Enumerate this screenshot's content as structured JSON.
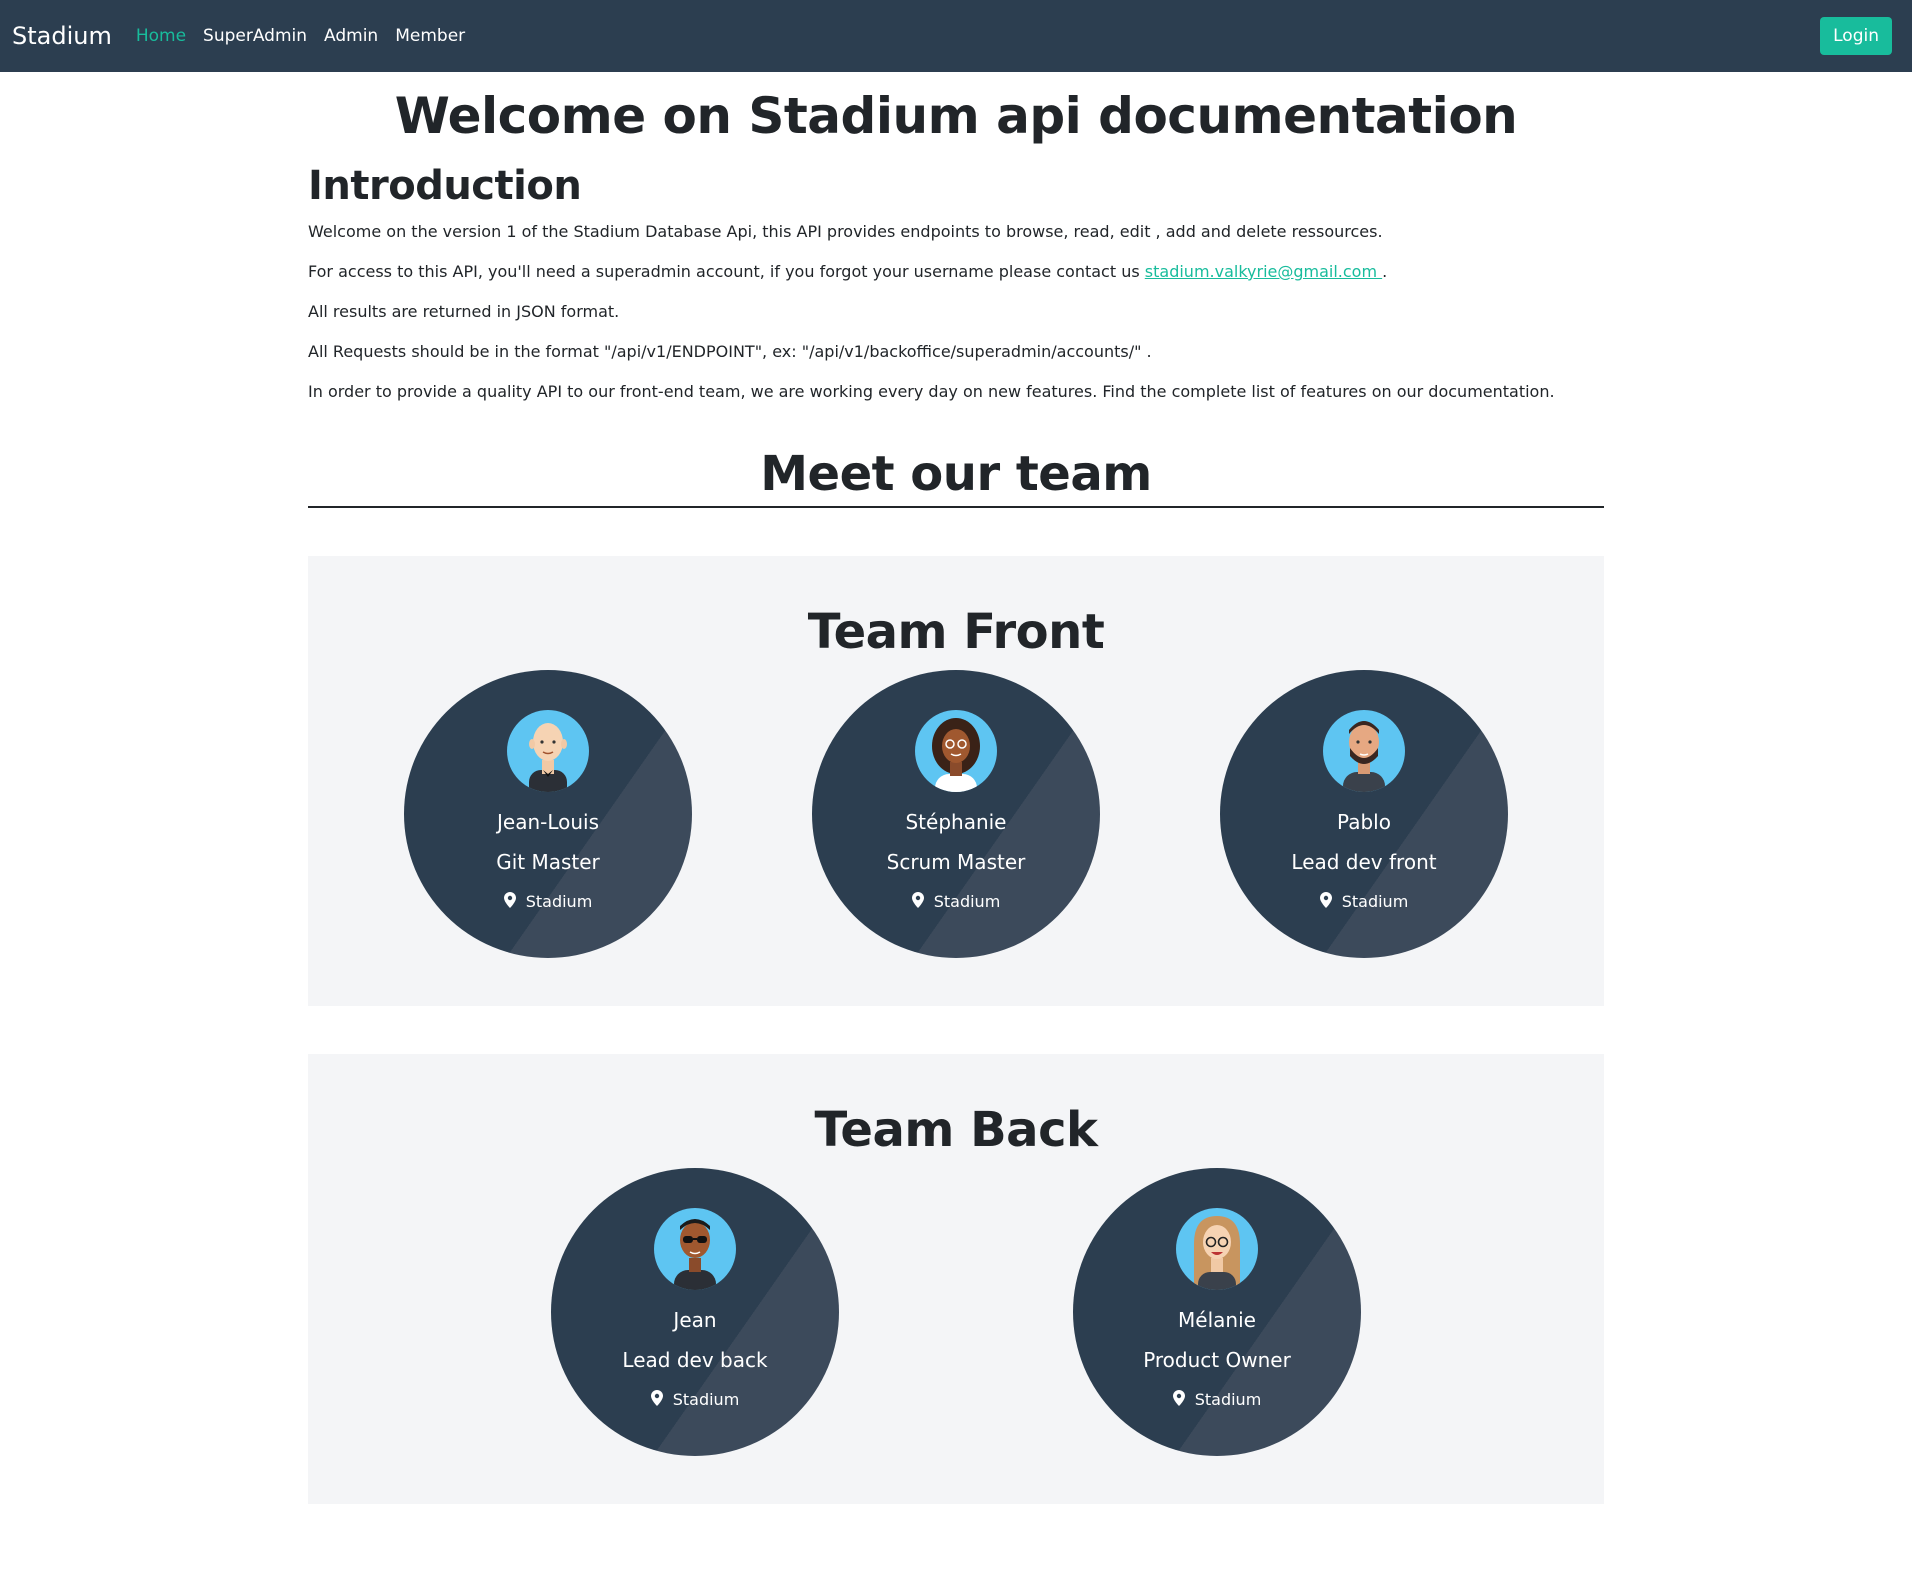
{
  "navbar": {
    "brand": "Stadium",
    "links": [
      "Home",
      "SuperAdmin",
      "Admin",
      "Member"
    ],
    "login_label": "Login"
  },
  "main": {
    "title": "Welcome on Stadium api documentation",
    "intro_title": "Introduction",
    "p1": "Welcome on the version 1 of the Stadium Database Api, this API provides endpoints to browse, read, edit , add and delete ressources.",
    "p2_before": "For access to this API, you'll need a superadmin account, if you forgot your username please contact us ",
    "p2_email": "stadium.valkyrie@gmail.com ",
    "p2_after": ".",
    "p3": "All results are returned in JSON format.",
    "p4": "All Requests should be in the format \"/api/v1/ENDPOINT\", ex: \"/api/v1/backoffice/superadmin/accounts/\" .",
    "p5": "In order to provide a quality API to our front-end team, we are working every day on new features. Find the complete list of features on our documentation.",
    "team_heading": "Meet our team"
  },
  "team_front": {
    "title": "Team Front",
    "members": [
      {
        "name": "Jean-Louis",
        "role": "Git Master",
        "location": "Stadium"
      },
      {
        "name": "Stéphanie",
        "role": "Scrum Master",
        "location": "Stadium"
      },
      {
        "name": "Pablo",
        "role": "Lead dev front",
        "location": "Stadium"
      }
    ]
  },
  "team_back": {
    "title": "Team Back",
    "members": [
      {
        "name": "Jean",
        "role": "Lead dev back",
        "location": "Stadium"
      },
      {
        "name": "Mélanie",
        "role": "Product Owner",
        "location": "Stadium"
      }
    ]
  },
  "colors": {
    "navbar": "#2c3e50",
    "accent": "#18bc9c",
    "card": "#2c3e50",
    "section_bg": "#f4f5f7",
    "avatar_bg": "#5ec5f2"
  },
  "icons": {
    "location": "map-marker-icon"
  }
}
